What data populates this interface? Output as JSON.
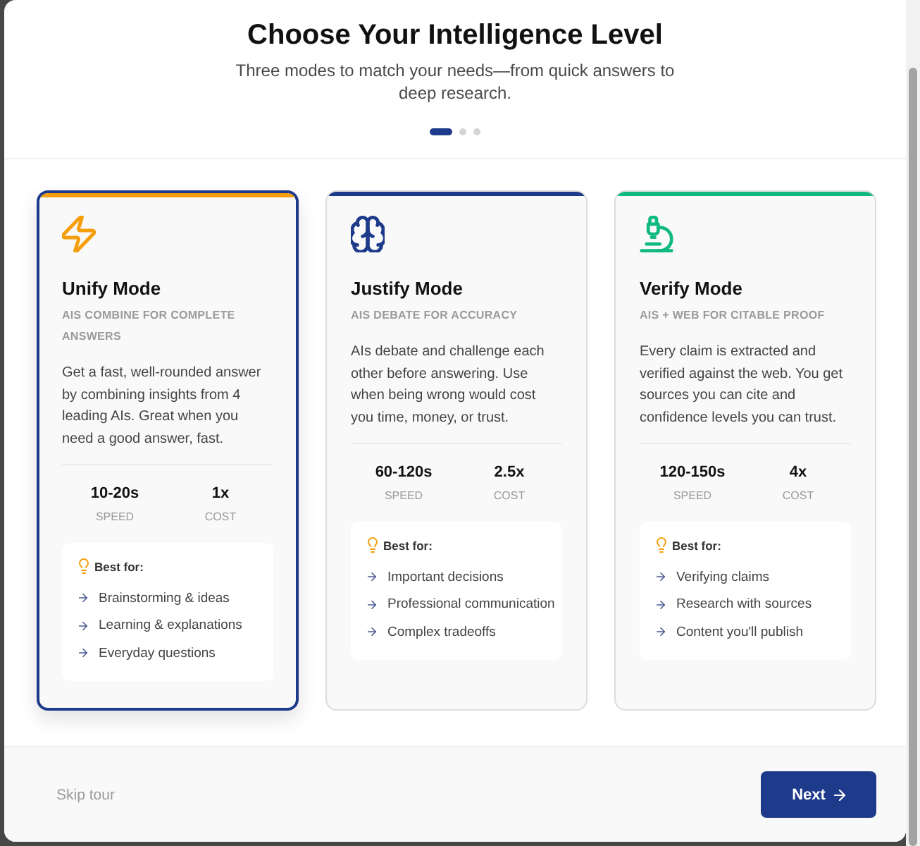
{
  "header": {
    "title": "Choose Your Intelligence Level",
    "subtitle": "Three modes to match your needs—from quick answers to deep research."
  },
  "steps": [
    {
      "selected": true
    },
    {
      "selected": false
    },
    {
      "selected": false
    }
  ],
  "modes": [
    {
      "title": "Unify Mode",
      "tagline": "AIS COMBINE FOR COMPLETE ANSWERS",
      "description": "Get a fast, well-rounded answer by combining insights from 4 leading AIs. Great when you need a good answer, fast.",
      "color": "#f59e0b",
      "selected": true,
      "stats": [
        {
          "value": "10-20s",
          "label": "SPEED"
        },
        {
          "value": "1x",
          "label": "COST"
        }
      ],
      "best_for": {
        "heading": "Best for:",
        "items": [
          "Brainstorming & ideas",
          "Learning & explanations",
          "Everyday questions"
        ]
      }
    },
    {
      "title": "Justify Mode",
      "tagline": "AIS DEBATE FOR ACCURACY",
      "description": "AIs debate and challenge each other before answering. Use when being wrong would cost you time, money, or trust.",
      "color": "#1e3a8a",
      "selected": false,
      "stats": [
        {
          "value": "60-120s",
          "label": "SPEED"
        },
        {
          "value": "2.5x",
          "label": "COST"
        }
      ],
      "best_for": {
        "heading": "Best for:",
        "items": [
          "Important decisions",
          "Professional communication",
          "Complex tradeoffs"
        ]
      }
    },
    {
      "title": "Verify Mode",
      "tagline": "AIS + WEB FOR CITABLE PROOF",
      "description": "Every claim is extracted and verified against the web. You get sources you can cite and confidence levels you can trust.",
      "color": "#10b981",
      "selected": false,
      "stats": [
        {
          "value": "120-150s",
          "label": "SPEED"
        },
        {
          "value": "4x",
          "label": "COST"
        }
      ],
      "best_for": {
        "heading": "Best for:",
        "items": [
          "Verifying claims",
          "Research with sources",
          "Content you'll publish"
        ]
      }
    }
  ],
  "footer": {
    "skip": "Skip tour",
    "next": "Next"
  }
}
